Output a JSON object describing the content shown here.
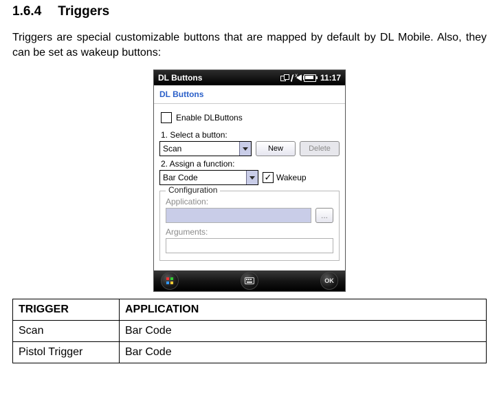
{
  "heading": {
    "number": "1.6.4",
    "title": "Triggers"
  },
  "paragraph": "Triggers are special customizable buttons that are mapped by default by DL Mobile. Also, they can be set as wakeup buttons:",
  "screenshot": {
    "topbar": {
      "app_title": "DL Buttons",
      "clock": "11:17"
    },
    "subtitle": "DL Buttons",
    "enable_label": "Enable DLButtons",
    "step1_label": "1. Select a button:",
    "dropdown1_value": "Scan",
    "btn_new": "New",
    "btn_delete": "Delete",
    "step2_label": "2. Assign a function:",
    "dropdown2_value": "Bar Code",
    "wakeup_label": "Wakeup",
    "config": {
      "legend": "Configuration",
      "application_label": "Application:",
      "arguments_label": "Arguments:",
      "browse_btn": "..."
    },
    "bottombar": {
      "ok": "OK"
    }
  },
  "table": {
    "headers": [
      "TRIGGER",
      "APPLICATION"
    ],
    "rows": [
      {
        "trigger": "Scan",
        "application": "Bar Code"
      },
      {
        "trigger": "Pistol Trigger",
        "application": "Bar Code"
      }
    ]
  }
}
